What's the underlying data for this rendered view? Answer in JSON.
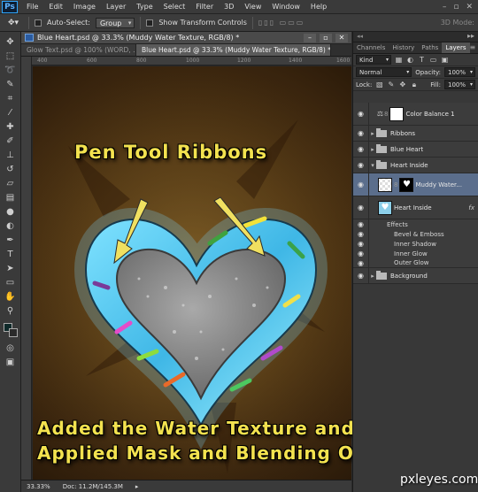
{
  "app": {
    "logo": "Ps"
  },
  "menu": [
    "File",
    "Edit",
    "Image",
    "Layer",
    "Type",
    "Select",
    "Filter",
    "3D",
    "View",
    "Window",
    "Help"
  ],
  "options_bar": {
    "auto_select_label": "Auto-Select:",
    "auto_select_value": "Group",
    "show_transform_label": "Show Transform Controls",
    "mode_3d_label": "3D Mode:"
  },
  "document": {
    "window_title": "Blue Heart.psd @ 33.3% (Muddy Water Texture, RGB/8) *",
    "tabs": [
      {
        "label": "Glow Text.psd @ 100% (WORD, ...",
        "active": false
      },
      {
        "label": "Blue Heart.psd @ 33.3% (Muddy Water Texture, RGB/8) *",
        "active": true
      }
    ],
    "ruler_marks": [
      "400",
      "600",
      "800",
      "1000",
      "1200",
      "1400",
      "1600"
    ],
    "zoom": "33.33%",
    "doc_size": "Doc: 11.2M/145.3M"
  },
  "canvas": {
    "caption_top": "Pen Tool Ribbons",
    "caption_bottom_line1": "Added the Water Texture and",
    "caption_bottom_line2": "Applied Mask and Blending Options"
  },
  "panels": {
    "tabs": [
      "Channels",
      "History",
      "Paths",
      "Layers"
    ],
    "active_tab": "Layers",
    "filter_kind": "Kind",
    "blend_mode": "Normal",
    "opacity_label": "Opacity:",
    "opacity_value": "100%",
    "lock_label": "Lock:",
    "fill_label": "Fill:",
    "fill_value": "100%",
    "layers": [
      {
        "name": "Color Balance 1",
        "type": "adjustment"
      },
      {
        "name": "Ribbons",
        "type": "group"
      },
      {
        "name": "Blue Heart",
        "type": "group"
      },
      {
        "name": "Heart Inside",
        "type": "group-open"
      },
      {
        "name": "Muddy Water...",
        "type": "masked",
        "selected": true
      },
      {
        "name": "Heart Inside",
        "type": "fx-layer"
      },
      {
        "name": "Background",
        "type": "group"
      }
    ],
    "effects_label": "Effects",
    "effects": [
      "Bevel & Emboss",
      "Inner Shadow",
      "Inner Glow",
      "Outer Glow"
    ],
    "fx_badge": "fx"
  },
  "watermark": "pxleyes.com",
  "colors": {
    "caption": "#f3e24f",
    "heart_ribbon": "#4ec9ee",
    "selected_layer": "#5b6e8c"
  }
}
